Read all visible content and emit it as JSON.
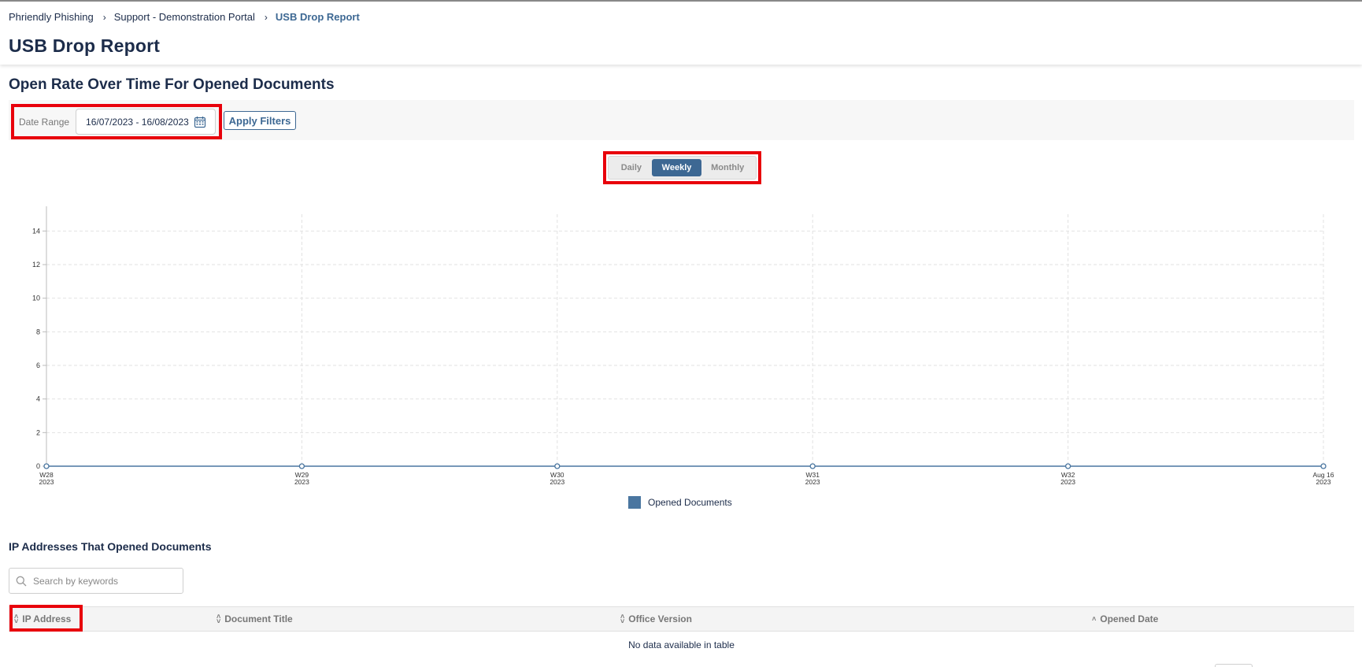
{
  "breadcrumb": {
    "items": [
      "Phriendly Phishing",
      "Support - Demonstration Portal"
    ],
    "current": "USB Drop Report",
    "separator": "›"
  },
  "page_title": "USB Drop Report",
  "chart_section": {
    "title": "Open Rate Over Time For Opened Documents"
  },
  "filters": {
    "date_range_label": "Date Range",
    "date_range_value": "16/07/2023 - 16/08/2023",
    "apply_label": "Apply Filters"
  },
  "period_toggle": {
    "options": [
      "Daily",
      "Weekly",
      "Monthly"
    ],
    "selected": "Weekly"
  },
  "colors": {
    "accent": "#3d6893",
    "series": "#4a76a0",
    "heading": "#1c2c4a",
    "highlight": "#e8000b"
  },
  "chart_data": {
    "type": "line",
    "x": [
      "W28 2023",
      "W29 2023",
      "W30 2023",
      "W31 2023",
      "W32 2023",
      "Aug 16 2023"
    ],
    "x_tick_labels": [
      [
        "W28",
        "2023"
      ],
      [
        "W29",
        "2023"
      ],
      [
        "W30",
        "2023"
      ],
      [
        "W31",
        "2023"
      ],
      [
        "W32",
        "2023"
      ],
      [
        "Aug 16",
        "2023"
      ]
    ],
    "series": [
      {
        "name": "Opened Documents",
        "values": [
          0,
          0,
          0,
          0,
          0,
          0
        ]
      }
    ],
    "ylim": [
      0,
      15
    ],
    "y_ticks": [
      0,
      2,
      4,
      6,
      8,
      10,
      12,
      14
    ],
    "grid": true,
    "legend": "bottom-center"
  },
  "table_section": {
    "title": "IP Addresses That Opened Documents",
    "search_placeholder": "Search by keywords",
    "columns": [
      "IP Address",
      "Document Title",
      "Office Version",
      "Opened Date"
    ],
    "empty_message": "No data available in table"
  }
}
